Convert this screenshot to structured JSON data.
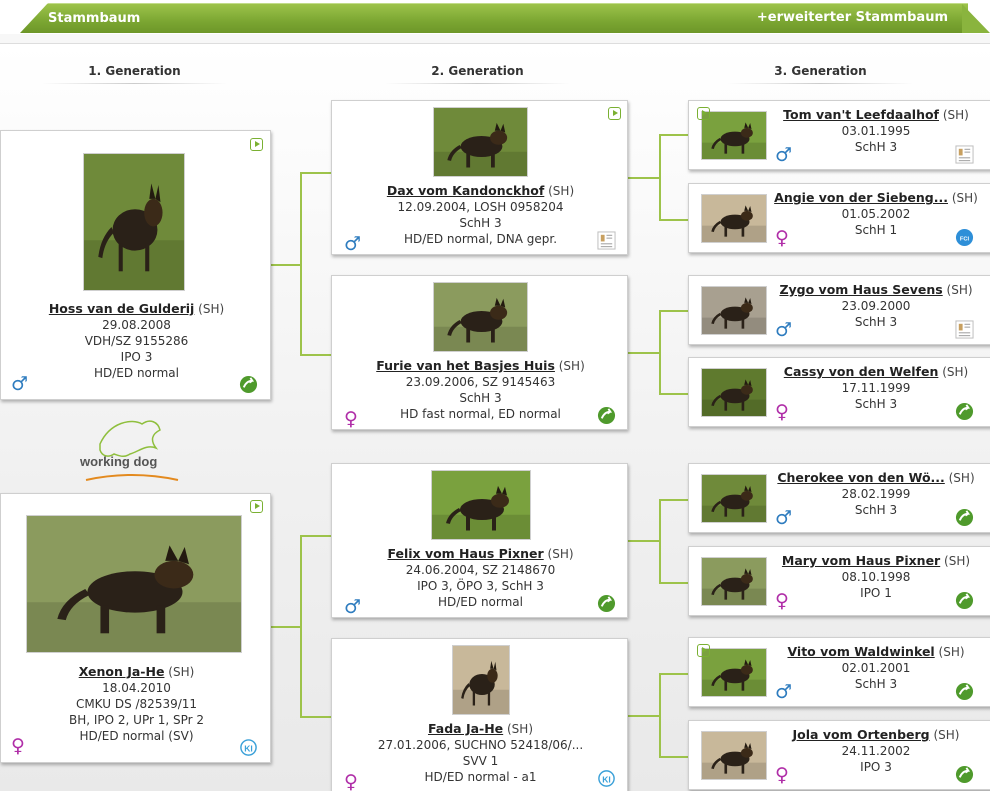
{
  "header": {
    "title": "Stammbaum",
    "extended_link": "+erweiterter Stammbaum"
  },
  "generations": [
    "1. Generation",
    "2. Generation",
    "3. Generation"
  ],
  "logo_text": "working dog",
  "gen1": [
    {
      "name": "Hoss van de Gulderij",
      "breed": "(SH)",
      "lines": [
        "29.08.2008",
        "VDH/SZ 9155286",
        "IPO 3",
        "HD/ED normal"
      ],
      "sex": "♂",
      "badge": "arrow-badge-icon",
      "video": true
    },
    {
      "name": "Xenon Ja-He",
      "breed": "(SH)",
      "lines": [
        "18.04.2010",
        "CMKU DS /82539/11",
        "BH, IPO 2, UPr 1, SPr 2",
        "HD/ED normal (SV)"
      ],
      "sex": "♀",
      "badge": "kk-badge-icon",
      "video": true
    }
  ],
  "gen2": [
    {
      "name": "Dax vom Kandonckhof",
      "breed": "(SH)",
      "lines": [
        "12.09.2004, LOSH 0958204",
        "SchH 3",
        "HD/ED normal, DNA gepr."
      ],
      "sex": "♂",
      "badge": "doc-badge-icon",
      "video": true
    },
    {
      "name": "Furie van het Basjes Huis",
      "breed": "(SH)",
      "lines": [
        "23.09.2006, SZ 9145463",
        "SchH 3",
        "HD fast normal, ED normal"
      ],
      "sex": "♀",
      "badge": "arrow-badge-icon",
      "video": false
    },
    {
      "name": "Felix vom Haus Pixner",
      "breed": "(SH)",
      "lines": [
        "24.06.2004, SZ 2148670",
        "IPO 3, ÖPO 3, SchH 3",
        "HD/ED normal"
      ],
      "sex": "♂",
      "badge": "arrow-badge-icon",
      "video": false
    },
    {
      "name": "Fada Ja-He",
      "breed": "(SH)",
      "lines": [
        "27.01.2006, SUCHNO 52418/06/...",
        "SVV 1",
        "HD/ED normal - a1"
      ],
      "sex": "♀",
      "badge": "kk-badge-icon",
      "video": false
    }
  ],
  "gen3": [
    {
      "name": "Tom van't Leefdaalhof",
      "breed": "(SH)",
      "lines": [
        "03.01.1995",
        "SchH 3"
      ],
      "sex": "♂",
      "badge": "doc-badge-icon",
      "video": true
    },
    {
      "name": "Angie von der Siebeng...",
      "breed": "(SH)",
      "lines": [
        "01.05.2002",
        "SchH 1"
      ],
      "sex": "♀",
      "badge": "fci-badge-icon",
      "video": false
    },
    {
      "name": "Zygo vom Haus Sevens",
      "breed": "(SH)",
      "lines": [
        "23.09.2000",
        "SchH 3"
      ],
      "sex": "♂",
      "badge": "doc-badge-icon",
      "video": false
    },
    {
      "name": "Cassy von den Welfen",
      "breed": "(SH)",
      "lines": [
        "17.11.1999",
        "SchH 3"
      ],
      "sex": "♀",
      "badge": "arrow-badge-icon",
      "video": false
    },
    {
      "name": "Cherokee von den Wö...",
      "breed": "(SH)",
      "lines": [
        "28.02.1999",
        "SchH 3"
      ],
      "sex": "♂",
      "badge": "arrow-badge-icon",
      "video": false
    },
    {
      "name": "Mary vom Haus Pixner",
      "breed": "(SH)",
      "lines": [
        "08.10.1998",
        "IPO 1"
      ],
      "sex": "♀",
      "badge": "arrow-badge-icon",
      "video": false
    },
    {
      "name": "Vito vom Waldwinkel",
      "breed": "(SH)",
      "lines": [
        "02.01.2001",
        "SchH 3"
      ],
      "sex": "♂",
      "badge": "arrow-badge-icon",
      "video": true
    },
    {
      "name": "Jola vom Ortenberg",
      "breed": "(SH)",
      "lines": [
        "24.11.2002",
        "IPO 3"
      ],
      "sex": "♀",
      "badge": "arrow-badge-icon",
      "video": false
    }
  ],
  "colors": {
    "green": "#7ba632",
    "male": "#2e7cbf",
    "female": "#b02ea8"
  }
}
